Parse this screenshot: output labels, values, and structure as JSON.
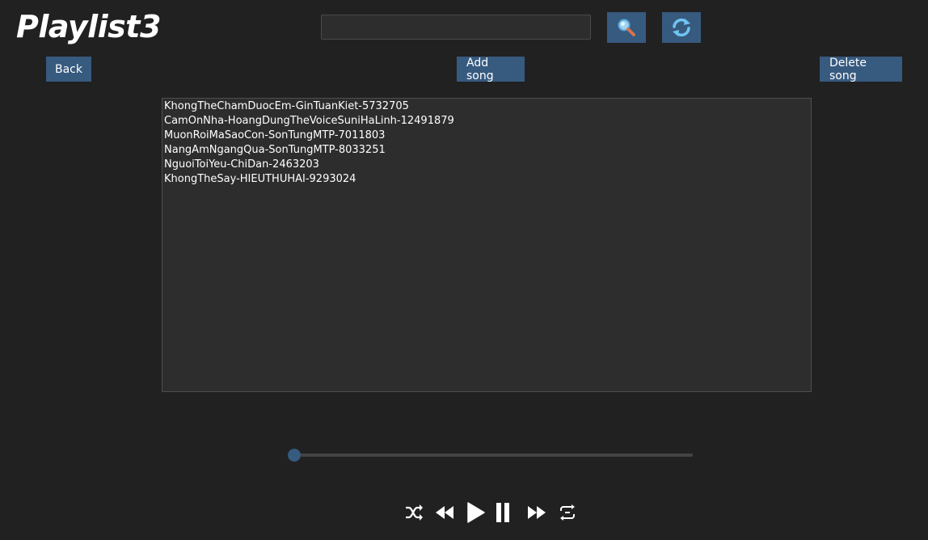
{
  "window": {
    "title": "Playlist3"
  },
  "search": {
    "value": "",
    "placeholder": "",
    "button_icon": "magnifier-icon",
    "refresh_icon": "refresh-icon"
  },
  "toolbar": {
    "back_label": "Back",
    "add_label": "Add song",
    "delete_label": "Delete song"
  },
  "songs": [
    "KhongTheChamDuocEm-GinTuanKiet-5732705",
    "CamOnNha-HoangDungTheVoiceSuniHaLinh-12491879",
    "MuonRoiMaSaoCon-SonTungMTP-7011803",
    "NangAmNgangQua-SonTungMTP-8033251",
    "NguoiToiYeu-ChiDan-2463203",
    "KhongTheSay-HIEUTHUHAI-9293024"
  ],
  "progress": {
    "fraction": 0.0
  },
  "controls": [
    "shuffle-icon",
    "rewind-icon",
    "play-icon",
    "pause-icon",
    "fast-forward-icon",
    "repeat-icon"
  ],
  "colors": {
    "accent": "#375a7f",
    "background": "#212121",
    "panel": "#2d2d2d"
  }
}
